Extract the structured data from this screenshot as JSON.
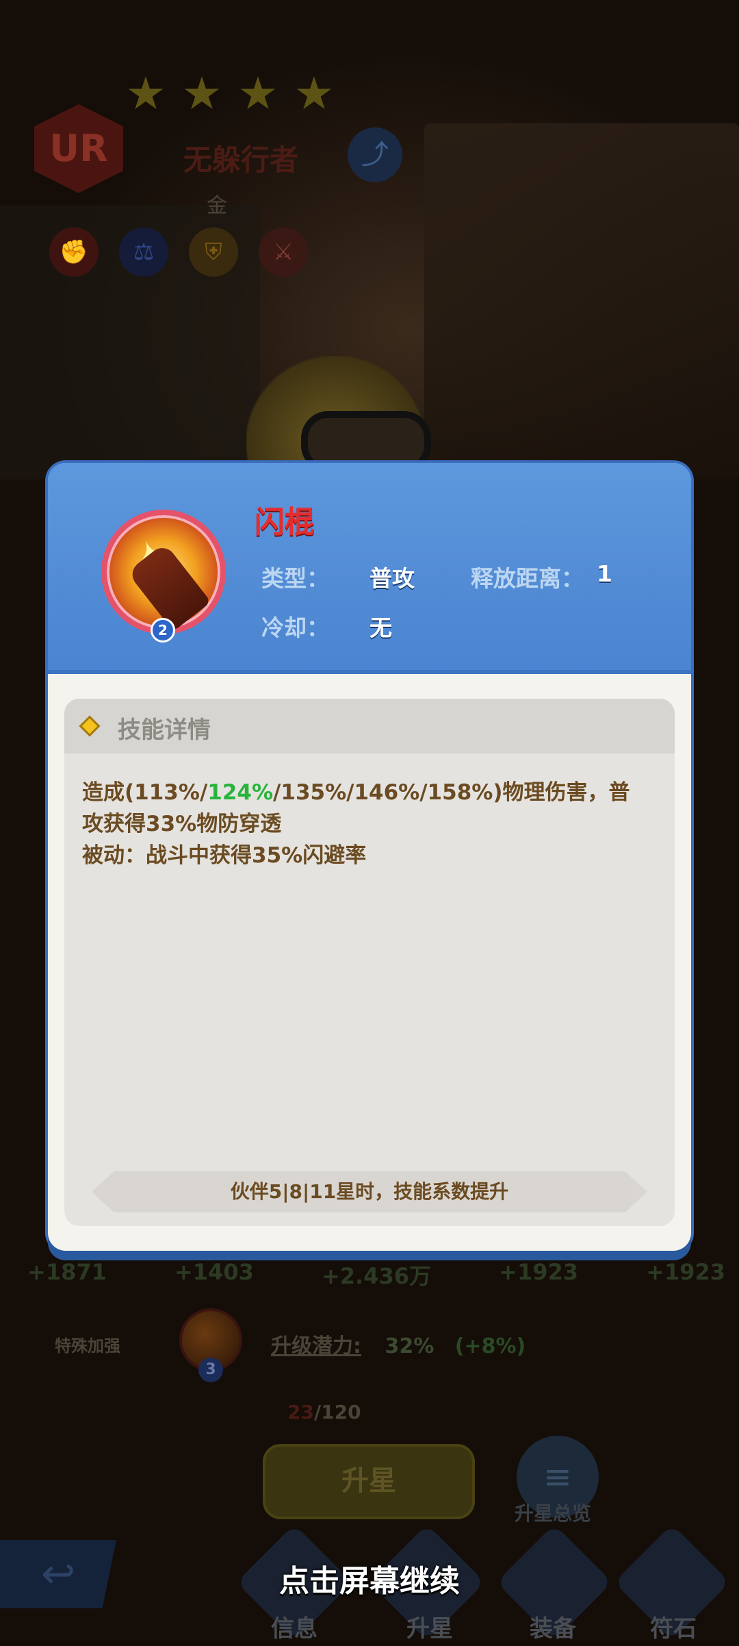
{
  "hero": {
    "rarity": "UR",
    "name": "无躲行者",
    "subtitle": "金",
    "star_count": 4,
    "share_icon": "share-icon",
    "attribute_icons": [
      "fist-icon",
      "scale-icon",
      "shield-icon",
      "sword-badge-icon"
    ]
  },
  "skill_modal": {
    "skill_name": "闪棍",
    "skill_level": "2",
    "type_label": "类型：",
    "type_value": "普攻",
    "range_label": "释放距离：",
    "range_value": "1",
    "cooldown_label": "冷却：",
    "cooldown_value": "无",
    "detail_title": "技能详情",
    "desc_part1": "造成(113%/",
    "desc_highlight": "124%",
    "desc_part2": "/135%/146%/158%)物理伤害，普",
    "desc_line2": "攻获得33%物防穿透",
    "desc_line3": "被动：战斗中获得35%闪避率",
    "upgrade_note": "伙伴5|8|11星时，技能系数提升",
    "highlight_color": "#28b43c"
  },
  "stats": [
    "+1871",
    "+1403",
    "+2.436万",
    "+1923",
    "+1923"
  ],
  "special": {
    "label": "特殊加强",
    "icon_level": "3",
    "potential_label": "升级潜力:",
    "potential_value": "32%",
    "potential_delta": "(+8%)"
  },
  "progress": {
    "current": "23",
    "max": "/120"
  },
  "buttons": {
    "star_up": "升星",
    "overview": "升星总览"
  },
  "nav": {
    "info": "信息",
    "star_up": "升星",
    "equipment": "装备",
    "rune": "符石"
  },
  "continue_hint": "点击屏幕继续"
}
